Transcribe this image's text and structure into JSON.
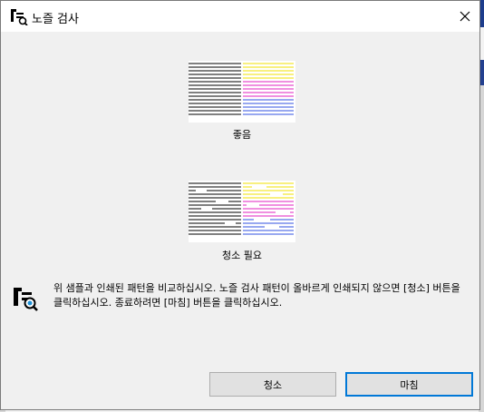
{
  "window": {
    "title": "노즐 검사",
    "close_icon": "close-icon",
    "app_icon": "nozzle-check-printer-icon"
  },
  "patterns": {
    "good_caption": "좋음",
    "bad_caption": "청소 필요"
  },
  "message": {
    "text": "위 샘플과 인쇄된 패턴을 비교하십시오. 노즐 검사 패턴이 올바르게 인쇄되지 않으면 [청소] 버튼을 클릭하십시오. 종료하려면 [마침] 버튼을 클릭하십시오.",
    "icon": "info-printer-icon"
  },
  "buttons": {
    "clean_label": "청소",
    "finish_label": "마침"
  },
  "colors": {
    "black_ink": "#000000",
    "yellow_ink": "#f0e000",
    "magenta_ink": "#e020c0",
    "cyan_ink": "#3050e0",
    "accent": "#0078d7"
  }
}
